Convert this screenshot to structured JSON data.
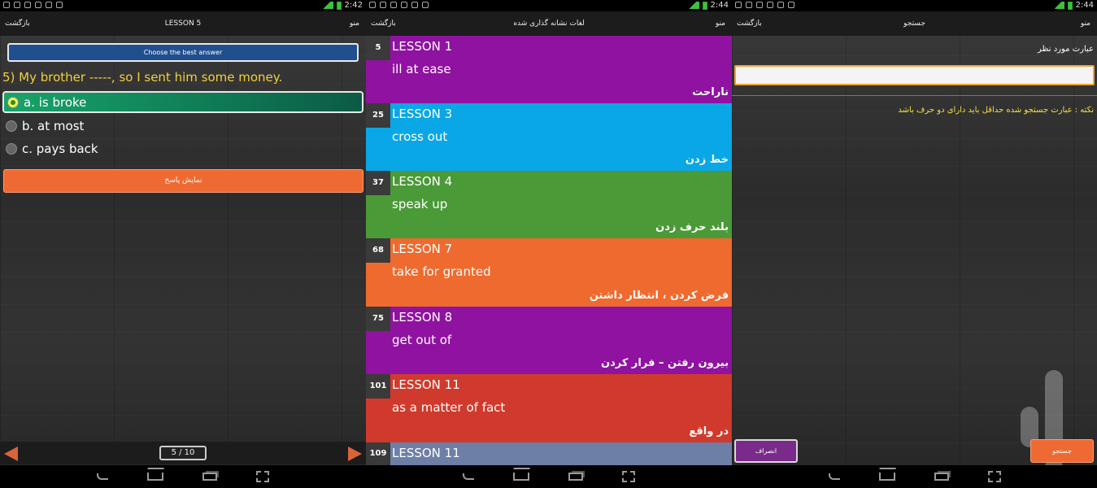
{
  "status": {
    "panel1_time": "2:42",
    "panel2_time": "2:44",
    "panel3_time": "2:44"
  },
  "quiz": {
    "back_label": "بازگشت",
    "title": "LESSON 5",
    "menu_label": "منو",
    "instruction": "Choose the best answer",
    "question": "5) My brother -----, so I sent him some money.",
    "options": [
      {
        "label": "a. is broke",
        "selected": true
      },
      {
        "label": "b. at most",
        "selected": false
      },
      {
        "label": "c. pays back",
        "selected": false
      }
    ],
    "show_answer_label": "نمایش پاسخ",
    "page_indicator": "5 / 10"
  },
  "bookmarks": {
    "back_label": "بازگشت",
    "title": "لغات نشانه گذاری شده",
    "menu_label": "منو",
    "items": [
      {
        "num": "5",
        "lesson": "LESSON 1",
        "phrase": "ill at ease",
        "meaning": "ناراحت",
        "color": "#8f12a0"
      },
      {
        "num": "25",
        "lesson": "LESSON 3",
        "phrase": "cross out",
        "meaning": "خط زدن",
        "color": "#0aa7e6"
      },
      {
        "num": "37",
        "lesson": "LESSON 4",
        "phrase": "speak up",
        "meaning": "بلند حرف زدن",
        "color": "#4a9a38"
      },
      {
        "num": "68",
        "lesson": "LESSON 7",
        "phrase": "take for granted",
        "meaning": "فرض کردن ، انتظار داشتن",
        "color": "#ef6a2e"
      },
      {
        "num": "75",
        "lesson": "LESSON 8",
        "phrase": "get out of",
        "meaning": "بیرون رفتن – فرار کردن",
        "color": "#8f12a0"
      },
      {
        "num": "101",
        "lesson": "LESSON 11",
        "phrase": "as a matter of fact",
        "meaning": "در واقع",
        "color": "#d03a2c"
      },
      {
        "num": "109",
        "lesson": "LESSON 11",
        "phrase": "",
        "meaning": "",
        "color": "#6d7fa6"
      }
    ]
  },
  "search": {
    "back_label": "بازگشت",
    "title": "جستجو",
    "menu_label": "منو",
    "field_label": "عبارت مورد نظر",
    "input_value": "",
    "note": "نکته : عبارت جستجو شده حداقل باید دارای دو حرف باشد",
    "cancel_label": "انصراف",
    "search_label": "جستجو"
  }
}
